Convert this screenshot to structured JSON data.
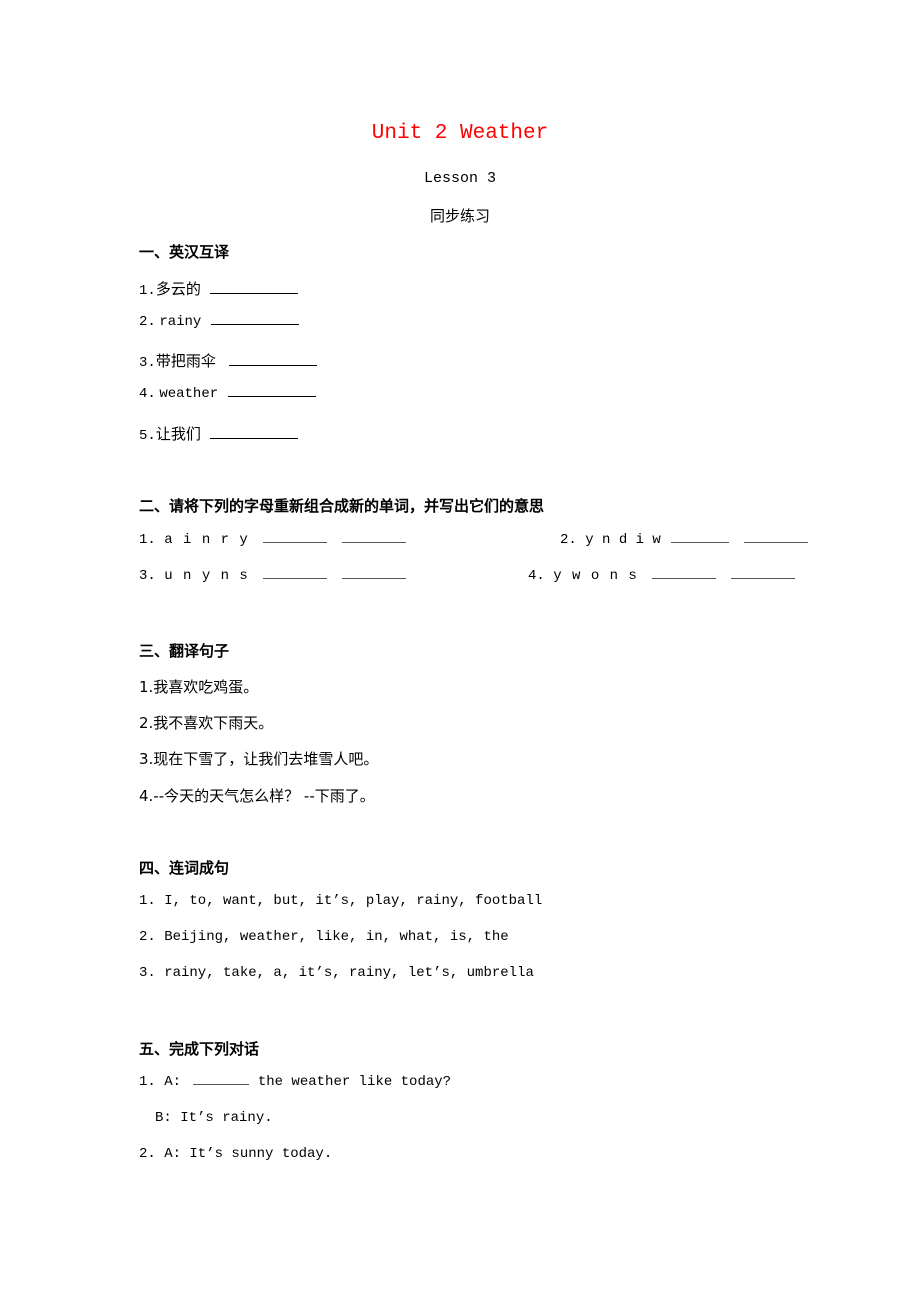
{
  "header": {
    "title": "Unit 2 Weather",
    "lesson": "Lesson 3",
    "subtitle": "同步练习",
    "title_color": "#ff0000"
  },
  "section1": {
    "heading": "一、英汉互译",
    "items": [
      {
        "num": "1.",
        "text": "多云的"
      },
      {
        "num": "2.",
        "text": "rainy"
      },
      {
        "num": "3.",
        "text": "带把雨伞"
      },
      {
        "num": "4.",
        "text": "weather"
      },
      {
        "num": "5.",
        "text": "让我们"
      }
    ]
  },
  "section2": {
    "heading": "二、请将下列的字母重新组合成新的单词，并写出它们的意思",
    "items": [
      {
        "num": "1.",
        "letters": "a i n r y"
      },
      {
        "num": "2.",
        "letters": "y n d i w"
      },
      {
        "num": "3.",
        "letters": "u n y n s"
      },
      {
        "num": "4.",
        "letters": "y w o n s"
      }
    ]
  },
  "section3": {
    "heading": "三、翻译句子",
    "items": [
      "1.我喜欢吃鸡蛋。",
      "2.我不喜欢下雨天。",
      "3.现在下雪了，让我们去堆雪人吧。",
      "4.--今天的天气怎么样？ --下雨了。"
    ]
  },
  "section4": {
    "heading": "四、连词成句",
    "items": [
      "1. I, to, want, but, it’s, play, rainy, football",
      "2. Beijing, weather, like, in, what, is, the",
      "3. rainy, take, a, it’s, rainy, let’s, umbrella"
    ]
  },
  "section5": {
    "heading": "五、完成下列对话",
    "lines": {
      "q1_prefix": "1. A:",
      "q1_suffix": "the weather like today?",
      "q1_b": "B: It’s rainy.",
      "q2_a": "2. A: It’s sunny today."
    }
  }
}
